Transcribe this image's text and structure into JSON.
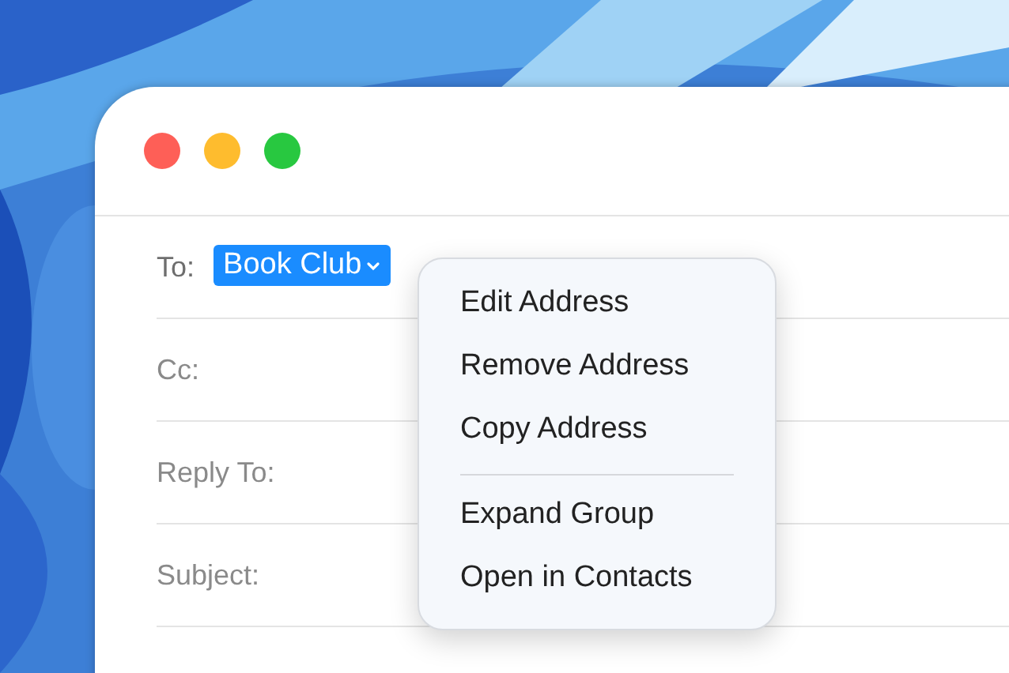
{
  "window": {
    "fields": [
      {
        "label": "To:",
        "tokens": [
          {
            "text": "Book Club",
            "selected": true
          }
        ]
      },
      {
        "label": "Cc:"
      },
      {
        "label": "Reply To:"
      },
      {
        "label": "Subject:"
      }
    ]
  },
  "context_menu": {
    "groups": [
      {
        "items": [
          {
            "label": "Edit Address"
          },
          {
            "label": "Remove Address"
          },
          {
            "label": "Copy Address"
          }
        ]
      },
      {
        "items": [
          {
            "label": "Expand Group"
          },
          {
            "label": "Open in Contacts"
          }
        ]
      }
    ]
  }
}
